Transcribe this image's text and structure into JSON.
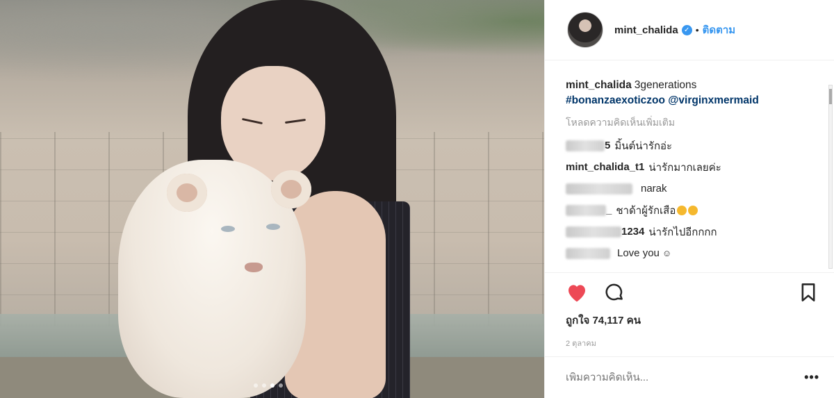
{
  "post": {
    "username": "mint_chalida",
    "follow_label": "ติดตาม",
    "separator": "•",
    "verified_glyph": "✓"
  },
  "caption": {
    "username": "mint_chalida",
    "text": "3generations",
    "tags": "#bonanzaexoticzoo @virginxmermaid"
  },
  "load_more_label": "โหลดความคิดเห็นเพิ่มเติม",
  "comments": [
    {
      "user_visible": "5",
      "text": "มิ้นต์น่ารักอ่ะ"
    },
    {
      "user_visible": "mint_chalida_t1",
      "text": "น่ารักมากเลยค่ะ"
    },
    {
      "user_visible": "",
      "text": "narak"
    },
    {
      "user_visible": "_",
      "text": "ชาด้าผู้รักเสือ"
    },
    {
      "user_visible": "1234",
      "text": "น่ารักไปอีกกกก"
    },
    {
      "user_visible": "",
      "text": "Love you"
    }
  ],
  "likes_label": "ถูกใจ 74,117 คน",
  "date_label": "2 ตุลาคม",
  "add_comment_placeholder": "เพิ่มความคิดเห็น...",
  "more_label": "•••",
  "photo": {
    "slide_count": 4,
    "active_slide": 3
  },
  "icons": {
    "like": "heart-icon",
    "comment": "comment-bubble-icon",
    "save": "bookmark-icon"
  },
  "colors": {
    "like": "#ed4956",
    "link": "#3897f0",
    "hashtag": "#003569",
    "muted": "#999999"
  }
}
